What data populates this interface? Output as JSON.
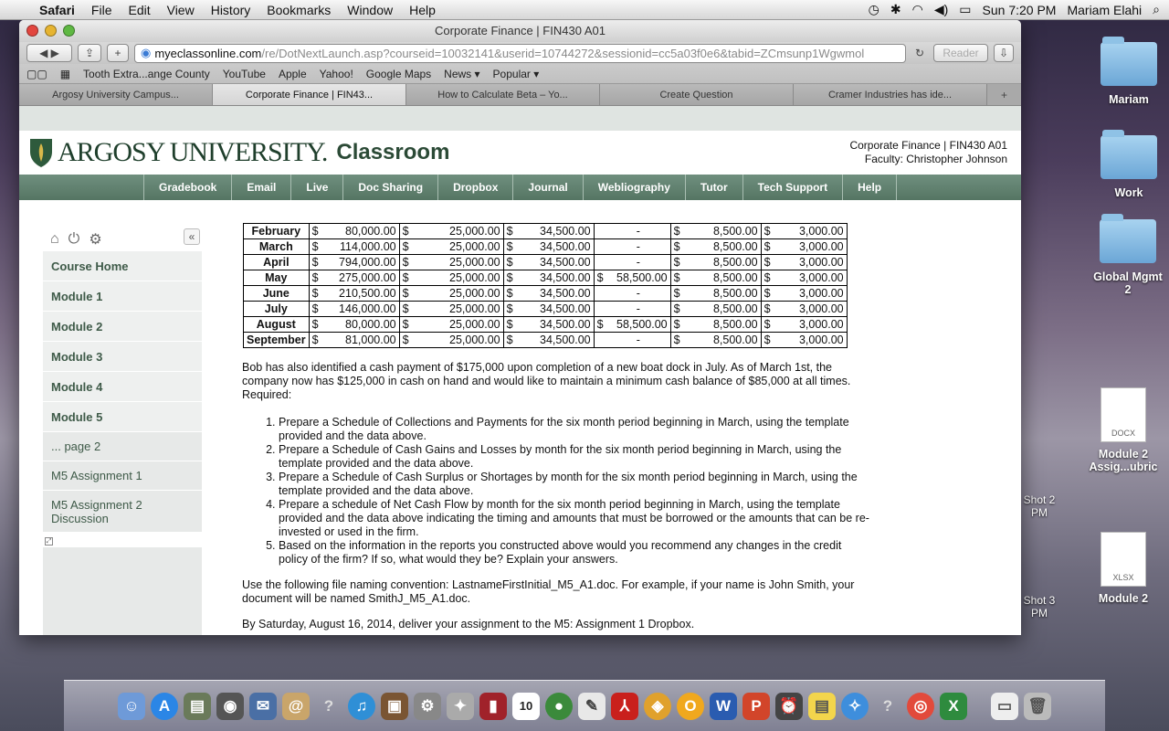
{
  "menubar": {
    "app": "Safari",
    "items": [
      "File",
      "Edit",
      "View",
      "History",
      "Bookmarks",
      "Window",
      "Help"
    ],
    "clock": "Sun 7:20 PM",
    "user": "Mariam Elahi"
  },
  "window": {
    "title": "Corporate Finance | FIN430 A01"
  },
  "address": {
    "host": "myeclassonline.com",
    "path": "/re/DotNextLaunch.asp?courseid=10032141&userid=10744272&sessionid=cc5a03f0e6&tabid=ZCmsunp1Wgwmol",
    "reader": "Reader"
  },
  "bookmarks": [
    "Tooth Extra...ange County",
    "YouTube",
    "Apple",
    "Yahoo!",
    "Google Maps",
    "News ▾",
    "Popular ▾"
  ],
  "tabs": [
    "Argosy University Campus...",
    "Corporate Finance | FIN43...",
    "How to Calculate Beta – Yo...",
    "Create Question",
    "Cramer Industries has ide..."
  ],
  "site": {
    "logo": "ARGOSY UNIVERSITY.",
    "classroom": "Classroom",
    "course": "Corporate Finance | FIN430 A01",
    "faculty": "Faculty:  Christopher Johnson"
  },
  "nav": [
    "Gradebook",
    "Email",
    "Live",
    "Doc Sharing",
    "Dropbox",
    "Journal",
    "Webliography",
    "Tutor",
    "Tech Support",
    "Help"
  ],
  "sidebar": {
    "items": [
      "Course Home",
      "Module 1",
      "Module 2",
      "Module 3",
      "Module 4",
      "Module 5"
    ],
    "subs": [
      "... page 2",
      "M5 Assignment 1",
      "M5 Assignment 2 Discussion"
    ]
  },
  "schedule": {
    "rows": [
      {
        "month": "February",
        "c1": "80,000.00",
        "c2": "25,000.00",
        "c3": "34,500.00",
        "c4": "-",
        "c5": "8,500.00",
        "c6": "3,000.00"
      },
      {
        "month": "March",
        "c1": "114,000.00",
        "c2": "25,000.00",
        "c3": "34,500.00",
        "c4": "-",
        "c5": "8,500.00",
        "c6": "3,000.00"
      },
      {
        "month": "April",
        "c1": "794,000.00",
        "c2": "25,000.00",
        "c3": "34,500.00",
        "c4": "-",
        "c5": "8,500.00",
        "c6": "3,000.00"
      },
      {
        "month": "May",
        "c1": "275,000.00",
        "c2": "25,000.00",
        "c3": "34,500.00",
        "c4": "58,500.00",
        "c5": "8,500.00",
        "c6": "3,000.00"
      },
      {
        "month": "June",
        "c1": "210,500.00",
        "c2": "25,000.00",
        "c3": "34,500.00",
        "c4": "-",
        "c5": "8,500.00",
        "c6": "3,000.00"
      },
      {
        "month": "July",
        "c1": "146,000.00",
        "c2": "25,000.00",
        "c3": "34,500.00",
        "c4": "-",
        "c5": "8,500.00",
        "c6": "3,000.00"
      },
      {
        "month": "August",
        "c1": "80,000.00",
        "c2": "25,000.00",
        "c3": "34,500.00",
        "c4": "58,500.00",
        "c5": "8,500.00",
        "c6": "3,000.00"
      },
      {
        "month": "September",
        "c1": "81,000.00",
        "c2": "25,000.00",
        "c3": "34,500.00",
        "c4": "-",
        "c5": "8,500.00",
        "c6": "3,000.00"
      }
    ]
  },
  "content": {
    "para1": " Bob has also identified a cash payment of $175,000 upon completion of a new boat dock in July.  As of March 1st, the company now has $125,000 in cash on hand and would like to maintain a minimum cash balance of $85,000 at all times.",
    "required": "Required:",
    "list": [
      "Prepare a Schedule of Collections and Payments for the six month period beginning in March, using the template provided and the data above.",
      "Prepare a Schedule of Cash Gains and Losses by month for the six month period beginning in March, using the template provided and the data above.",
      "Prepare a Schedule of Cash Surplus or Shortages by month for the six month period beginning in March, using the template provided and the data above.",
      "Prepare a schedule of Net Cash Flow by month for the six month period beginning in March, using the template provided and the data above indicating the timing and amounts that must be borrowed or the amounts that can be re-invested or used in the firm.",
      "Based on the information in the reports you constructed above would you recommend any changes in the credit policy of the firm?  If so, what would they be?  Explain your answers."
    ],
    "naming": "Use the following file naming convention: LastnameFirstInitial_M5_A1.doc. For example, if your name is John Smith, your document will be named SmithJ_M5_A1.doc.",
    "deadline": "By Saturday, August 16, 2014, deliver your assignment to the M5: Assignment 1 Dropbox."
  },
  "desktop": {
    "icons": [
      "Mariam",
      "Work",
      "Global Mgmt 2",
      "Module 2 Assig...ubric",
      "Module 2"
    ],
    "docx": "DOCX",
    "xlsx": "XLSX",
    "shot1": "Shot 2 PM",
    "shot2": "Shot 3 PM"
  },
  "dock": {
    "calendar_day": "10"
  }
}
